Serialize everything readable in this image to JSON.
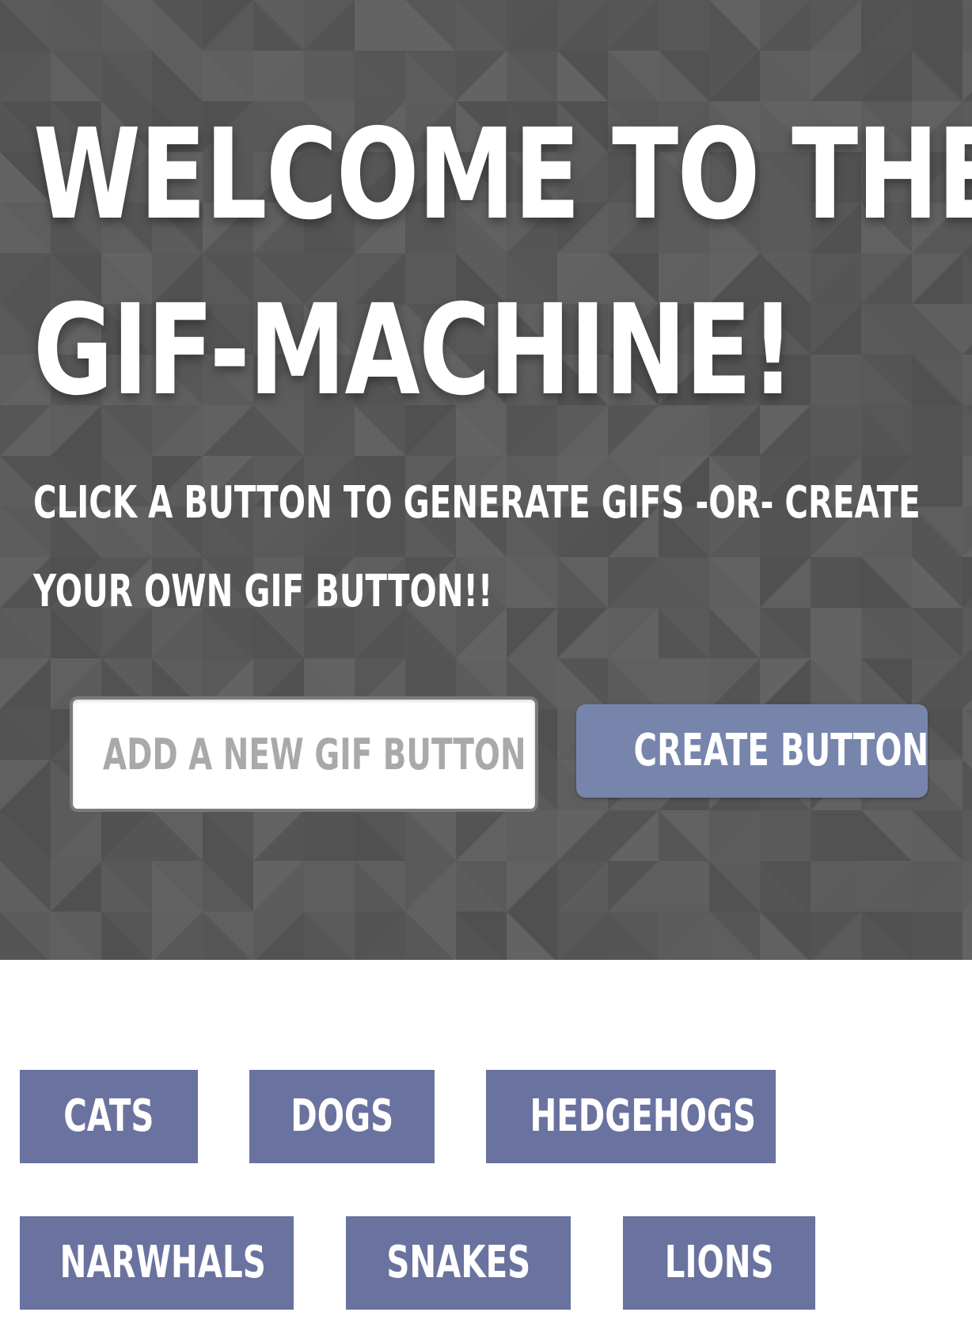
{
  "hero": {
    "title_line1": "WELCOME TO THE",
    "title_line2": "GIF-MACHINE!",
    "subtitle_line1": "CLICK A BUTTON TO GENERATE GIFS -OR- CREATE",
    "subtitle_line2": "YOUR OWN GIF BUTTON!!",
    "input_placeholder": "ADD A NEW GIF BUTTON",
    "input_value": "",
    "create_label": "CREATE BUTTON"
  },
  "gif_buttons": [
    {
      "label": "CATS"
    },
    {
      "label": "DOGS"
    },
    {
      "label": "HEDGEHOGS"
    },
    {
      "label": "NARWHALS"
    },
    {
      "label": "SNAKES"
    },
    {
      "label": "LIONS"
    }
  ],
  "colors": {
    "hero_background": "#5a5a5a",
    "create_button": "#7785ad",
    "gif_button": "#6a729f",
    "placeholder": "#a9a9a9"
  }
}
